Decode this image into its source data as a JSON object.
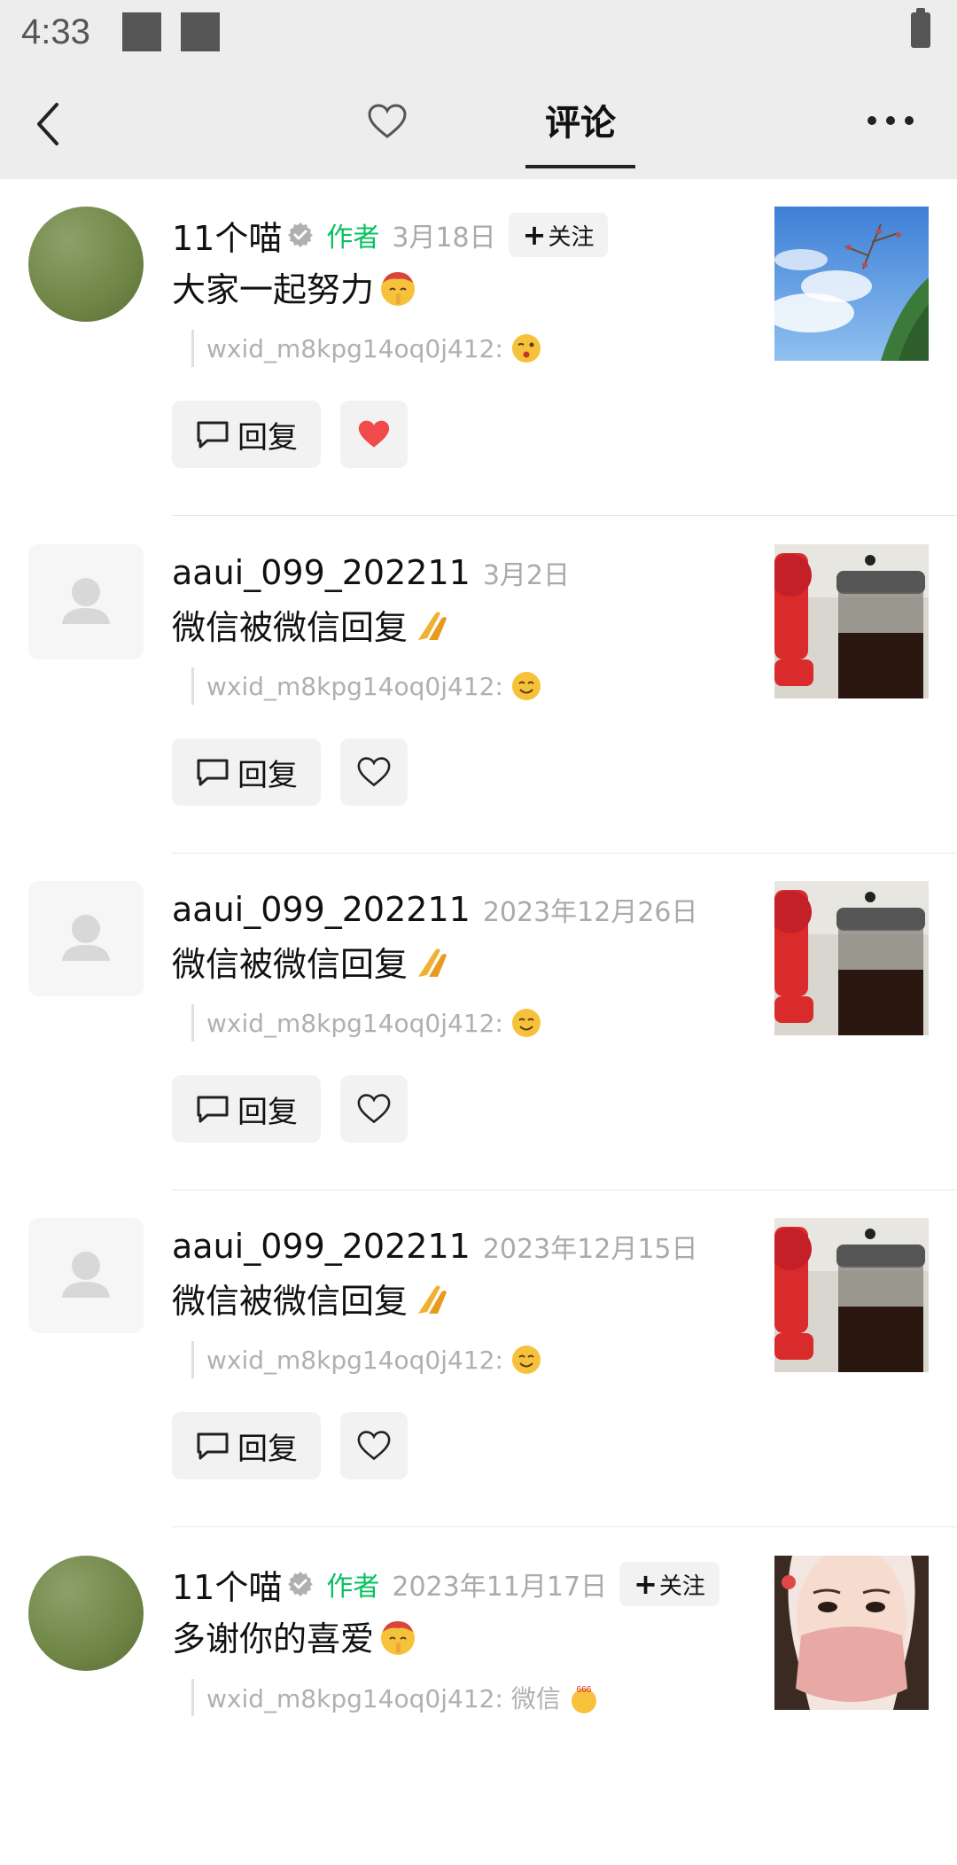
{
  "status": {
    "time": "4:33"
  },
  "topbar": {
    "title": "评论",
    "back_icon": "chevron-left-icon",
    "like_icon": "heart-outline-icon",
    "more_icon": "more-dots-icon"
  },
  "comments": [
    {
      "name": "11个喵",
      "author": "作者",
      "date": "3月18日",
      "follow": "关注",
      "text": "大家一起努力",
      "text_emoji": "shushing-face",
      "quote": "wxid_m8kpg14oq0j412:",
      "quote_emoji": "winking-face",
      "reply": "回复",
      "liked": true,
      "thumb": "sky-tree"
    },
    {
      "name": "aaui_099_202211",
      "date": "3月2日",
      "text": "微信被微信回复",
      "text_emoji": "folded-hands",
      "quote": "wxid_m8kpg14oq0j412:",
      "quote_emoji": "smiling-face",
      "reply": "回复",
      "liked": false,
      "thumb": "cup-fan"
    },
    {
      "name": "aaui_099_202211",
      "date": "2023年12月26日",
      "text": "微信被微信回复",
      "text_emoji": "folded-hands",
      "quote": "wxid_m8kpg14oq0j412:",
      "quote_emoji": "smiling-face",
      "reply": "回复",
      "liked": false,
      "thumb": "cup-fan"
    },
    {
      "name": "aaui_099_202211",
      "date": "2023年12月15日",
      "text": "微信被微信回复",
      "text_emoji": "folded-hands",
      "quote": "wxid_m8kpg14oq0j412:",
      "quote_emoji": "smiling-face",
      "reply": "回复",
      "liked": false,
      "thumb": "cup-fan"
    },
    {
      "name": "11个喵",
      "author": "作者",
      "date": "2023年11月17日",
      "follow": "关注",
      "text": "多谢你的喜爱",
      "text_emoji": "shushing-face",
      "quote": "wxid_m8kpg14oq0j412: 微信",
      "quote_emoji": "666-sticker",
      "reply": "回复",
      "liked": false,
      "thumb": "woman-mask"
    }
  ]
}
